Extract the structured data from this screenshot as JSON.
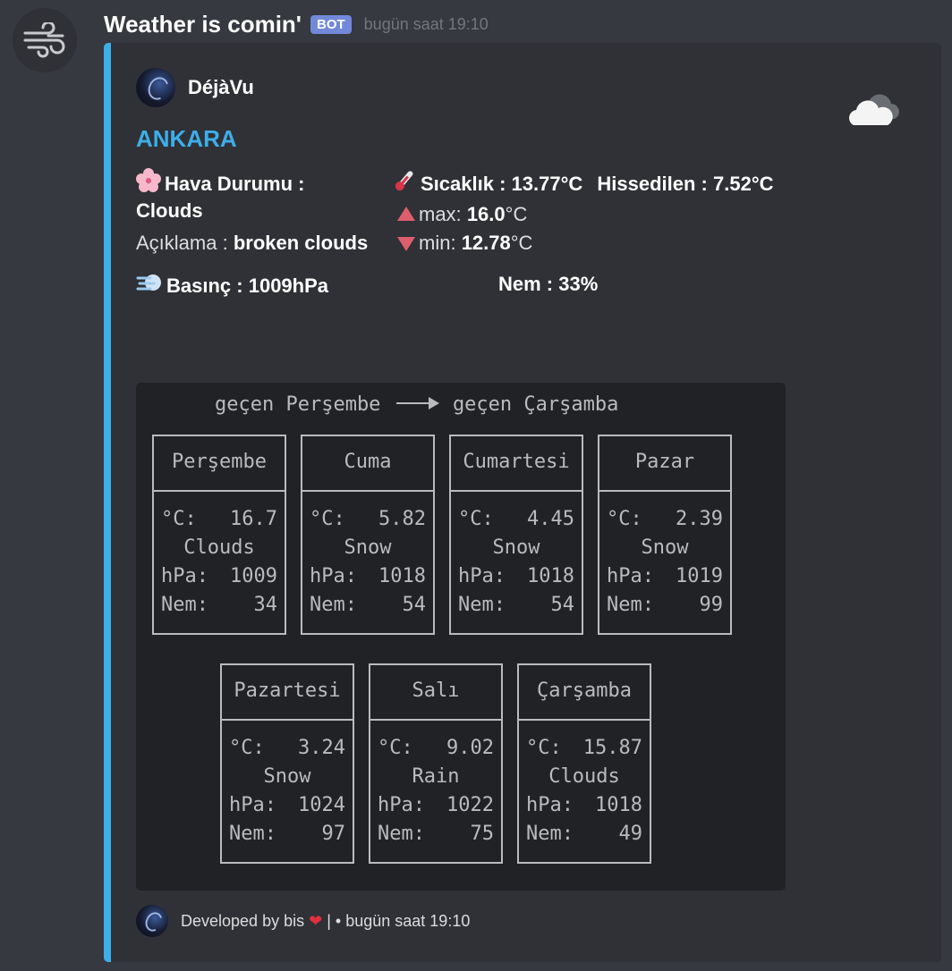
{
  "message": {
    "username": "Weather is comin'",
    "bot_tag": "BOT",
    "timestamp": "bugün saat 19:10",
    "avatar_icon": "wind-icon"
  },
  "embed": {
    "accent_color": "#3daee9",
    "author": {
      "name": "DéjàVu",
      "icon": "galaxy-avatar-icon"
    },
    "thumbnail_icon": "cloud-icon",
    "title": "ANKARA",
    "fields": {
      "hava_label": "Hava Durumu :",
      "hava_value": "Clouds",
      "aciklama_label": "Açıklama :",
      "aciklama_value": "broken clouds",
      "sicaklik_label": "Sıcaklık :",
      "sicaklik_value": "13.77°C",
      "hissedilen_label": "Hissedilen :",
      "hissedilen_value": "7.52°C",
      "max_label": "max:",
      "max_value": "16.0",
      "max_unit": "°C",
      "min_label": "min:",
      "min_value": "12.78",
      "min_unit": "°C",
      "basinc_label": "Basınç :",
      "basinc_value": "1009hPa",
      "nem_label": "Nem :",
      "nem_value": "33%"
    },
    "forecast": {
      "header_from": "geçen Perşembe",
      "header_to": "geçen Çarşamba",
      "temp_label": "°C:",
      "pressure_label": "hPa:",
      "humidity_label": "Nem:",
      "days": [
        {
          "name": "Perşembe",
          "temp": "16.7",
          "condition": "Clouds",
          "pressure": "1009",
          "humidity": "34"
        },
        {
          "name": "Cuma",
          "temp": "5.82",
          "condition": "Snow",
          "pressure": "1018",
          "humidity": "54"
        },
        {
          "name": "Cumartesi",
          "temp": "4.45",
          "condition": "Snow",
          "pressure": "1018",
          "humidity": "54"
        },
        {
          "name": "Pazar",
          "temp": "2.39",
          "condition": "Snow",
          "pressure": "1019",
          "humidity": "99"
        },
        {
          "name": "Pazartesi",
          "temp": "3.24",
          "condition": "Snow",
          "pressure": "1024",
          "humidity": "97"
        },
        {
          "name": "Salı",
          "temp": "9.02",
          "condition": "Rain",
          "pressure": "1022",
          "humidity": "75"
        },
        {
          "name": "Çarşamba",
          "temp": "15.87",
          "condition": "Clouds",
          "pressure": "1018",
          "humidity": "49"
        }
      ]
    },
    "footer": {
      "text": "Developed by bis",
      "separator": "| •",
      "timestamp": "bugün saat 19:10"
    }
  }
}
